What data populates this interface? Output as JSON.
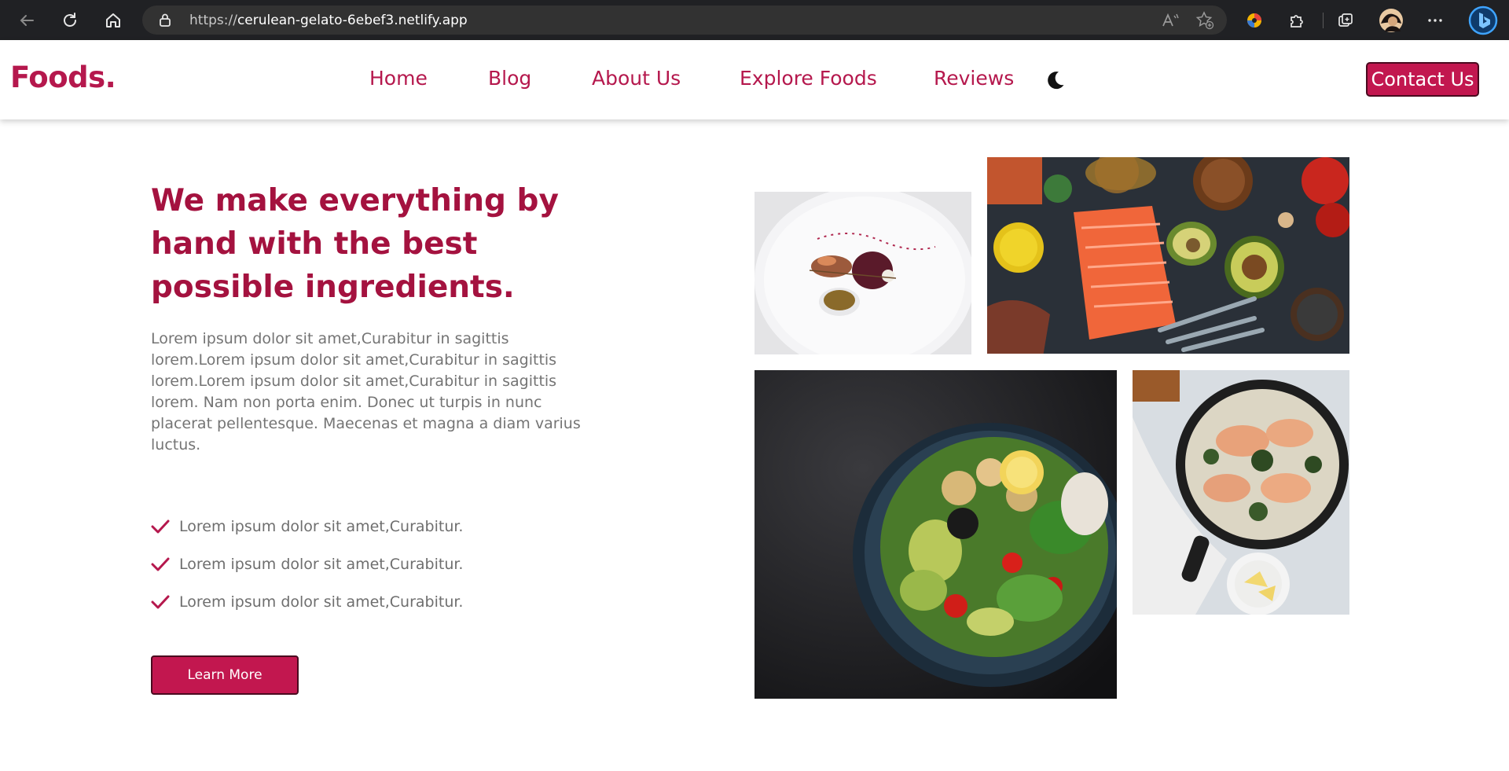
{
  "browser": {
    "url_prefix": "https://",
    "url_host": "cerulean-gelato-6ebef3.netlify.app"
  },
  "nav": {
    "logo": "Foods.",
    "links": [
      "Home",
      "Blog",
      "About Us",
      "Explore Foods",
      "Reviews"
    ],
    "contact_label": "Contact Us",
    "theme_icon": "moon-icon"
  },
  "hero": {
    "headline": "We make everything by hand with the best possible ingredients.",
    "paragraph": "Lorem ipsum dolor sit amet,Curabitur in sagittis lorem.Lorem ipsum dolor sit amet,Curabitur in sagittis lorem.Lorem ipsum dolor sit amet,Curabitur in sagittis lorem. Nam non porta enim. Donec ut turpis in nunc placerat pellentesque. Maecenas et magna a diam varius luctus.",
    "checklist": [
      "Lorem ipsum dolor sit amet,Curabitur.",
      "Lorem ipsum dolor sit amet,Curabitur.",
      "Lorem ipsum dolor sit amet,Curabitur."
    ],
    "button_label": "Learn More"
  },
  "colors": {
    "brand": "#b5184d",
    "heading": "#a4123f",
    "button": "#c2174f",
    "chrome": "#202124"
  }
}
